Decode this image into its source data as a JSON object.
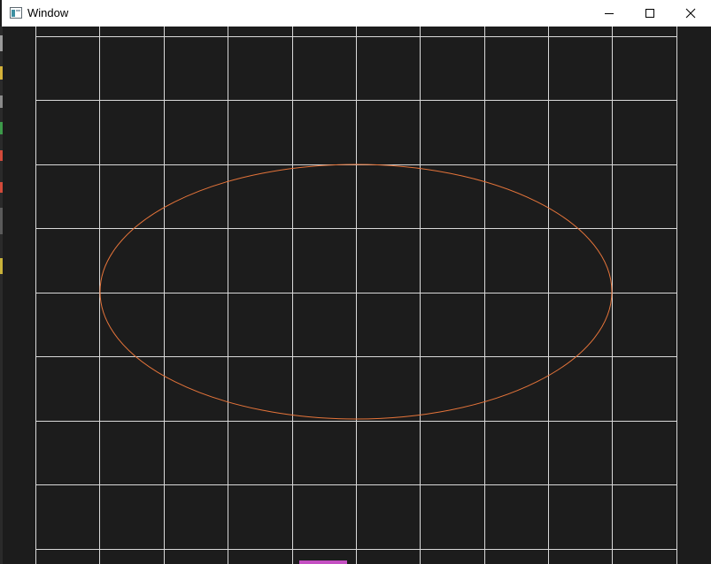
{
  "window": {
    "title": "Window",
    "controls": {
      "minimize": "minimize-icon",
      "maximize": "maximize-icon",
      "close": "close-icon"
    }
  },
  "canvas": {
    "background": "#1c1c1c",
    "grid_color": "#d9d9d9",
    "shape": {
      "type": "ellipse",
      "stroke": "#e5743a"
    }
  },
  "colors": {
    "titlebar": "#ffffff",
    "taskbar_accent": "#c44fc2"
  }
}
